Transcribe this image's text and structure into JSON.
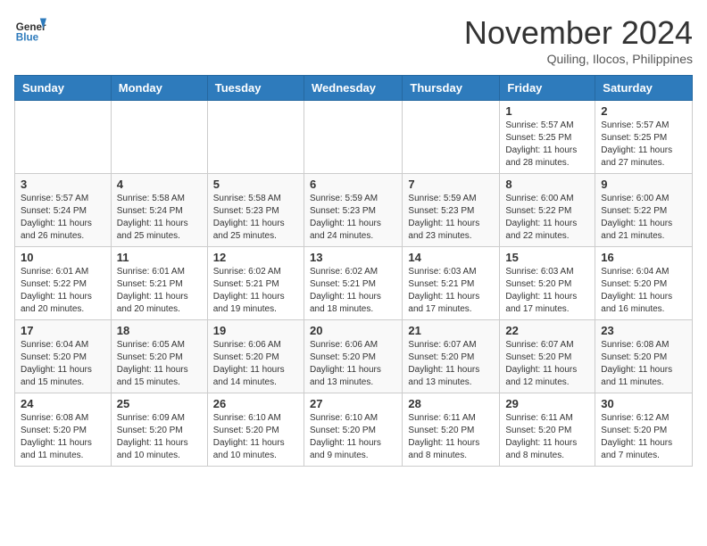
{
  "header": {
    "logo_line1": "General",
    "logo_line2": "Blue",
    "month": "November 2024",
    "location": "Quiling, Ilocos, Philippines"
  },
  "columns": [
    "Sunday",
    "Monday",
    "Tuesday",
    "Wednesday",
    "Thursday",
    "Friday",
    "Saturday"
  ],
  "weeks": [
    [
      {
        "day": "",
        "info": ""
      },
      {
        "day": "",
        "info": ""
      },
      {
        "day": "",
        "info": ""
      },
      {
        "day": "",
        "info": ""
      },
      {
        "day": "",
        "info": ""
      },
      {
        "day": "1",
        "info": "Sunrise: 5:57 AM\nSunset: 5:25 PM\nDaylight: 11 hours\nand 28 minutes."
      },
      {
        "day": "2",
        "info": "Sunrise: 5:57 AM\nSunset: 5:25 PM\nDaylight: 11 hours\nand 27 minutes."
      }
    ],
    [
      {
        "day": "3",
        "info": "Sunrise: 5:57 AM\nSunset: 5:24 PM\nDaylight: 11 hours\nand 26 minutes."
      },
      {
        "day": "4",
        "info": "Sunrise: 5:58 AM\nSunset: 5:24 PM\nDaylight: 11 hours\nand 25 minutes."
      },
      {
        "day": "5",
        "info": "Sunrise: 5:58 AM\nSunset: 5:23 PM\nDaylight: 11 hours\nand 25 minutes."
      },
      {
        "day": "6",
        "info": "Sunrise: 5:59 AM\nSunset: 5:23 PM\nDaylight: 11 hours\nand 24 minutes."
      },
      {
        "day": "7",
        "info": "Sunrise: 5:59 AM\nSunset: 5:23 PM\nDaylight: 11 hours\nand 23 minutes."
      },
      {
        "day": "8",
        "info": "Sunrise: 6:00 AM\nSunset: 5:22 PM\nDaylight: 11 hours\nand 22 minutes."
      },
      {
        "day": "9",
        "info": "Sunrise: 6:00 AM\nSunset: 5:22 PM\nDaylight: 11 hours\nand 21 minutes."
      }
    ],
    [
      {
        "day": "10",
        "info": "Sunrise: 6:01 AM\nSunset: 5:22 PM\nDaylight: 11 hours\nand 20 minutes."
      },
      {
        "day": "11",
        "info": "Sunrise: 6:01 AM\nSunset: 5:21 PM\nDaylight: 11 hours\nand 20 minutes."
      },
      {
        "day": "12",
        "info": "Sunrise: 6:02 AM\nSunset: 5:21 PM\nDaylight: 11 hours\nand 19 minutes."
      },
      {
        "day": "13",
        "info": "Sunrise: 6:02 AM\nSunset: 5:21 PM\nDaylight: 11 hours\nand 18 minutes."
      },
      {
        "day": "14",
        "info": "Sunrise: 6:03 AM\nSunset: 5:21 PM\nDaylight: 11 hours\nand 17 minutes."
      },
      {
        "day": "15",
        "info": "Sunrise: 6:03 AM\nSunset: 5:20 PM\nDaylight: 11 hours\nand 17 minutes."
      },
      {
        "day": "16",
        "info": "Sunrise: 6:04 AM\nSunset: 5:20 PM\nDaylight: 11 hours\nand 16 minutes."
      }
    ],
    [
      {
        "day": "17",
        "info": "Sunrise: 6:04 AM\nSunset: 5:20 PM\nDaylight: 11 hours\nand 15 minutes."
      },
      {
        "day": "18",
        "info": "Sunrise: 6:05 AM\nSunset: 5:20 PM\nDaylight: 11 hours\nand 15 minutes."
      },
      {
        "day": "19",
        "info": "Sunrise: 6:06 AM\nSunset: 5:20 PM\nDaylight: 11 hours\nand 14 minutes."
      },
      {
        "day": "20",
        "info": "Sunrise: 6:06 AM\nSunset: 5:20 PM\nDaylight: 11 hours\nand 13 minutes."
      },
      {
        "day": "21",
        "info": "Sunrise: 6:07 AM\nSunset: 5:20 PM\nDaylight: 11 hours\nand 13 minutes."
      },
      {
        "day": "22",
        "info": "Sunrise: 6:07 AM\nSunset: 5:20 PM\nDaylight: 11 hours\nand 12 minutes."
      },
      {
        "day": "23",
        "info": "Sunrise: 6:08 AM\nSunset: 5:20 PM\nDaylight: 11 hours\nand 11 minutes."
      }
    ],
    [
      {
        "day": "24",
        "info": "Sunrise: 6:08 AM\nSunset: 5:20 PM\nDaylight: 11 hours\nand 11 minutes."
      },
      {
        "day": "25",
        "info": "Sunrise: 6:09 AM\nSunset: 5:20 PM\nDaylight: 11 hours\nand 10 minutes."
      },
      {
        "day": "26",
        "info": "Sunrise: 6:10 AM\nSunset: 5:20 PM\nDaylight: 11 hours\nand 10 minutes."
      },
      {
        "day": "27",
        "info": "Sunrise: 6:10 AM\nSunset: 5:20 PM\nDaylight: 11 hours\nand 9 minutes."
      },
      {
        "day": "28",
        "info": "Sunrise: 6:11 AM\nSunset: 5:20 PM\nDaylight: 11 hours\nand 8 minutes."
      },
      {
        "day": "29",
        "info": "Sunrise: 6:11 AM\nSunset: 5:20 PM\nDaylight: 11 hours\nand 8 minutes."
      },
      {
        "day": "30",
        "info": "Sunrise: 6:12 AM\nSunset: 5:20 PM\nDaylight: 11 hours\nand 7 minutes."
      }
    ]
  ]
}
